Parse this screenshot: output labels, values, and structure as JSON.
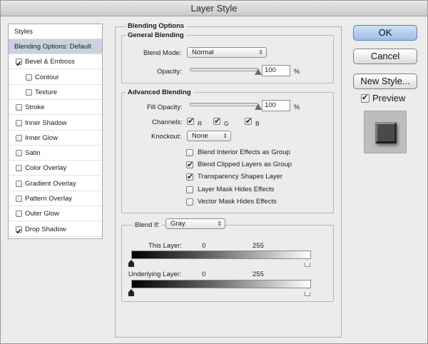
{
  "window": {
    "title": "Layer Style"
  },
  "styles_panel": {
    "header": "Styles",
    "items": [
      {
        "label": "Blending Options: Default",
        "checkbox": false,
        "checked": false,
        "selected": true,
        "indent": 0
      },
      {
        "label": "Bevel & Emboss",
        "checkbox": true,
        "checked": true,
        "selected": false,
        "indent": 0
      },
      {
        "label": "Contour",
        "checkbox": true,
        "checked": false,
        "selected": false,
        "indent": 1
      },
      {
        "label": "Texture",
        "checkbox": true,
        "checked": false,
        "selected": false,
        "indent": 1
      },
      {
        "label": "Stroke",
        "checkbox": true,
        "checked": false,
        "selected": false,
        "indent": 0
      },
      {
        "label": "Inner Shadow",
        "checkbox": true,
        "checked": false,
        "selected": false,
        "indent": 0
      },
      {
        "label": "Inner Glow",
        "checkbox": true,
        "checked": false,
        "selected": false,
        "indent": 0
      },
      {
        "label": "Satin",
        "checkbox": true,
        "checked": false,
        "selected": false,
        "indent": 0
      },
      {
        "label": "Color Overlay",
        "checkbox": true,
        "checked": false,
        "selected": false,
        "indent": 0
      },
      {
        "label": "Gradient Overlay",
        "checkbox": true,
        "checked": false,
        "selected": false,
        "indent": 0
      },
      {
        "label": "Pattern Overlay",
        "checkbox": true,
        "checked": false,
        "selected": false,
        "indent": 0
      },
      {
        "label": "Outer Glow",
        "checkbox": true,
        "checked": false,
        "selected": false,
        "indent": 0
      },
      {
        "label": "Drop Shadow",
        "checkbox": true,
        "checked": true,
        "selected": false,
        "indent": 0
      }
    ]
  },
  "blending_options": {
    "title": "Blending Options",
    "general": {
      "title": "General Blending",
      "blend_mode_label": "Blend Mode:",
      "blend_mode_value": "Normal",
      "opacity_label": "Opacity:",
      "opacity_value": "100",
      "opacity_unit": "%",
      "opacity_level": 1.0
    },
    "advanced": {
      "title": "Advanced Blending",
      "fill_opacity_label": "Fill Opacity:",
      "fill_opacity_value": "100",
      "fill_opacity_unit": "%",
      "fill_opacity_level": 1.0,
      "channels_label": "Channels:",
      "channels": [
        {
          "label": "R",
          "checked": true
        },
        {
          "label": "G",
          "checked": true
        },
        {
          "label": "B",
          "checked": true
        }
      ],
      "knockout_label": "Knockout:",
      "knockout_value": "None",
      "options": [
        {
          "label": "Blend Interior Effects as Group",
          "checked": false
        },
        {
          "label": "Blend Clipped Layers as Group",
          "checked": true
        },
        {
          "label": "Transparency Shapes Layer",
          "checked": true
        },
        {
          "label": "Layer Mask Hides Effects",
          "checked": false
        },
        {
          "label": "Vector Mask Hides Effects",
          "checked": false
        }
      ]
    },
    "blend_if": {
      "label": "Blend If:",
      "value": "Gray",
      "this_layer_label": "This Layer:",
      "this_layer_min": "0",
      "this_layer_max": "255",
      "underlying_label": "Underlying Layer:",
      "underlying_min": "0",
      "underlying_max": "255"
    }
  },
  "buttons": {
    "ok": "OK",
    "cancel": "Cancel",
    "new_style": "New Style..."
  },
  "preview": {
    "label": "Preview",
    "checked": true
  },
  "icons": {
    "checkmark": "check-icon",
    "dropdown": "updown-arrows-icon",
    "slider_thumb": "triangle-thumb-icon"
  }
}
